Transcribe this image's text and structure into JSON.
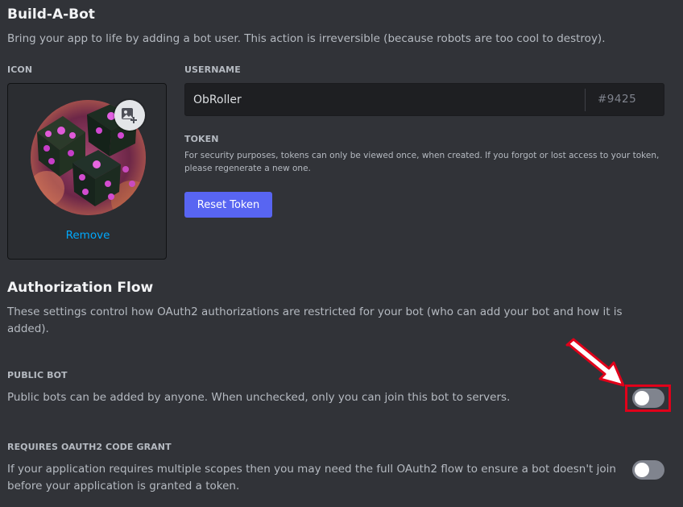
{
  "build_a_bot": {
    "title": "Build-A-Bot",
    "description": "Bring your app to life by adding a bot user. This action is irreversible (because robots are too cool to destroy)."
  },
  "icon_section": {
    "label": "ICON",
    "add_image_icon": "image-plus-icon",
    "remove_label": "Remove"
  },
  "username_section": {
    "label": "USERNAME",
    "value": "ObRoller",
    "discriminator": "#9425"
  },
  "token_section": {
    "label": "TOKEN",
    "description": "For security purposes, tokens can only be viewed once, when created. If you forgot or lost access to your token, please regenerate a new one.",
    "reset_button_label": "Reset Token"
  },
  "authorization_flow": {
    "title": "Authorization Flow",
    "description": "These settings control how OAuth2 authorizations are restricted for your bot (who can add your bot and how it is added)."
  },
  "public_bot": {
    "label": "PUBLIC BOT",
    "description": "Public bots can be added by anyone. When unchecked, only you can join this bot to servers.",
    "enabled": false
  },
  "oauth2_code_grant": {
    "label": "REQUIRES OAUTH2 CODE GRANT",
    "description": "If your application requires multiple scopes then you may need the full OAuth2 flow to ensure a bot doesn't join before your application is granted a token.",
    "enabled": false
  },
  "colors": {
    "background": "#313338",
    "accent": "#5865f2",
    "link": "#00a8fc",
    "toggle_off": "#80848e",
    "annotation_red": "#e0001a"
  }
}
